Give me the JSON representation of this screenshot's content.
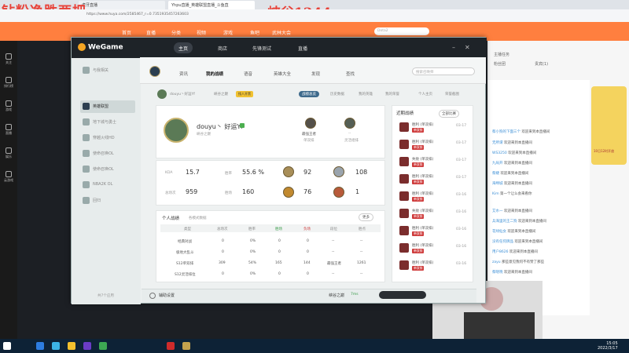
{
  "overlay": {
    "title": "钻粉净胜两把",
    "peak": "峡谷1244"
  },
  "browser": {
    "tabs": [
      "虎牙直播",
      "Yhpu直播_英雄联盟直播_斗鱼直",
      ""
    ],
    "url": "https://www.huya.com/2585467_r=0.7351935457263603"
  },
  "huya_nav": {
    "items": [
      "首页",
      "直播",
      "分类",
      "视频",
      "游戏",
      "鱼吧",
      "武林大会"
    ],
    "search_placeholder": "Dota2"
  },
  "left_rail": [
    "关注",
    "排行榜",
    "游戏",
    "直播",
    "娱乐",
    "云游戏",
    "直播"
  ],
  "wegame": {
    "logo": "WeGame",
    "top_tabs": [
      "主页",
      "商店",
      "先锋测试",
      "直播"
    ],
    "games": [
      "与我相关",
      "英雄联盟",
      "地下城与勇士",
      "穿越火线HD",
      "使命召唤OL",
      "使命召唤OL",
      "NBA2K OL",
      "回归"
    ],
    "games_footer": "共7个应用",
    "lol_tabs": [
      "资讯",
      "我的战绩",
      "语音",
      "英雄大全",
      "发现",
      "查找"
    ],
    "lol_search_placeholder": "搜索召唤师",
    "sub_tabs": [
      "douyu丶好运Yf",
      "峡谷之巅",
      "找人开黑",
      "战绩总览",
      "历史数据",
      "我的英雄",
      "我的荣誉",
      "个人主页",
      "荣誉截图"
    ],
    "profile": {
      "name": "douyu丶 好运Yf",
      "level_info": "峡谷之巅",
      "rank_label": "最强王者",
      "rank_sub": "单双排",
      "flex_label": "--",
      "flex_sub": "灵活组排"
    },
    "stats": {
      "kda_label": "KDA",
      "kda": "15.7",
      "winrate_label": "胜率",
      "winrate": "55.6 %",
      "games_label": "总场次",
      "games": "959",
      "wins_label": "胜场",
      "wins": "160",
      "badge1": "92",
      "badge2": "108",
      "badge3": "76",
      "badge4": "1"
    },
    "table": {
      "title": "个人战绩",
      "subtitle": "各模式数据",
      "more": "更多",
      "headers": [
        "类型",
        "总场次",
        "胜率",
        "胜场",
        "负场",
        "段位",
        "胜点"
      ],
      "rows": [
        [
          "经典对战",
          "0",
          "0%",
          "0",
          "0",
          "--",
          "--"
        ],
        [
          "极地大乱斗",
          "0",
          "0%",
          "0",
          "0",
          "--",
          "--"
        ],
        [
          "S12单双排",
          "309",
          "54%",
          "165",
          "144",
          "最强王者",
          "1261"
        ],
        [
          "S12灵活排位",
          "0",
          "0%",
          "0",
          "0",
          "--",
          "--"
        ]
      ]
    },
    "history": {
      "title": "近期战绩",
      "filter": "全部比赛",
      "rows": [
        {
          "result": "胜利 (单双排)",
          "mode": "单双排",
          "date": "03-17"
        },
        {
          "result": "胜利 (单双排)",
          "mode": "单双排",
          "date": "03-17"
        },
        {
          "result": "失败 (单双排)",
          "mode": "单双排",
          "date": "03-17"
        },
        {
          "result": "胜利 (单双排)",
          "mode": "单双排",
          "date": "03-17"
        },
        {
          "result": "胜利 (单双排)",
          "mode": "单双排",
          "date": "03-16"
        },
        {
          "result": "失败 (单双排)",
          "mode": "单双排",
          "date": "03-16"
        },
        {
          "result": "胜利 (单双排)",
          "mode": "单双排",
          "date": "03-16"
        },
        {
          "result": "胜利 (单双排)",
          "mode": "单双排",
          "date": "03-16"
        },
        {
          "result": "胜利 (单双排)",
          "mode": "单双排",
          "date": "03-16"
        },
        {
          "result": "失败 (单双排)",
          "mode": "单双排",
          "date": "03-16"
        }
      ]
    },
    "bottom": {
      "settings": "辅助设置",
      "server": "峡谷之巅",
      "ping": "7ms"
    }
  },
  "right_panel": {
    "header_tabs": [
      "主播任务",
      "粉丝团",
      "贵宾(1)"
    ],
    "chat": [
      {
        "user": "蔡小狗的下面三个",
        "msg": "欢迎来到本直播间"
      },
      {
        "user": "无所谓",
        "msg": "欢迎来到本直播间"
      },
      {
        "user": "WS3250",
        "msg": "欢迎来到本直播间"
      },
      {
        "user": "九局开",
        "msg": "欢迎来到本直播间"
      },
      {
        "user": "蔡婕",
        "msg": "欢迎来到本直播间"
      },
      {
        "user": "海绵城",
        "msg": "欢迎来到本直播间"
      },
      {
        "user": "Kim",
        "msg": "第一个让么会来看你"
      },
      {
        "user": "艾水一",
        "msg": "欢迎来到本直播间"
      },
      {
        "user": "兵海里的王二狗",
        "msg": "欢迎来到本直播间"
      },
      {
        "user": "花绿仙女",
        "msg": "欢迎来到本直播间"
      },
      {
        "user": "没有任何牌品",
        "msg": "欢迎来到本直播间"
      },
      {
        "user": "用户8626",
        "msg": "欢迎来到本直播间"
      },
      {
        "user": "zayu",
        "msg": "那些意见我何不有赞了那些"
      },
      {
        "user": "蔡晓晓",
        "msg": "欢迎来到本直播间"
      },
      {
        "user": "王老五",
        "msg": "欢迎来到本直播间"
      }
    ],
    "promo_text": "10日12时开放"
  },
  "taskbar": {
    "time": "15:05",
    "date": "2022/3/17"
  },
  "colors": {
    "accent": "#ff7f3f",
    "win": "#cf3c3c",
    "overlay": "#e8433a"
  }
}
